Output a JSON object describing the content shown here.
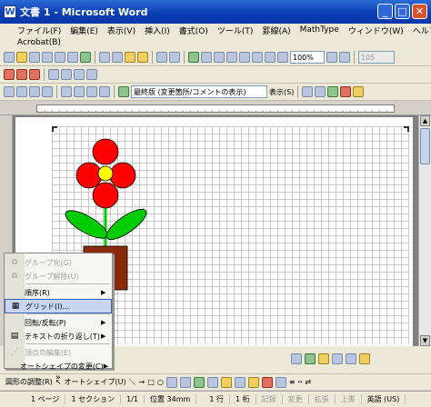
{
  "window": {
    "title": "文書 1 - Microsoft Word",
    "app_icon": "W"
  },
  "menu": [
    "ファイル(F)",
    "編集(E)",
    "表示(V)",
    "挿入(I)",
    "書式(O)",
    "ツール(T)",
    "罫線(A)",
    "MathType",
    "ウィンドウ(W)",
    "ヘルプ(H)"
  ],
  "menu_row2": "Acrobat(B)",
  "toolbar": {
    "zoom": "100%",
    "font_size": "105",
    "review_display": "最終版 (変更箇所/コメントの表示)",
    "show_button": "表示(S)"
  },
  "context_menu": {
    "items": [
      {
        "label": "グループ化(G)",
        "disabled": true,
        "submenu": false,
        "icon": "group-icon"
      },
      {
        "label": "グループ解除(U)",
        "disabled": true,
        "submenu": false,
        "icon": "ungroup-icon"
      },
      {
        "label": "順序(R)",
        "disabled": false,
        "submenu": true,
        "icon": ""
      },
      {
        "label": "グリッド(I)...",
        "disabled": false,
        "submenu": false,
        "icon": "grid-icon",
        "highlighted": true
      },
      {
        "label": "回転/反転(P)",
        "disabled": false,
        "submenu": true,
        "icon": ""
      },
      {
        "label": "テキストの折り返し(T)",
        "disabled": false,
        "submenu": true,
        "icon": "wrap-icon"
      },
      {
        "label": "頂点の編集(E)",
        "disabled": true,
        "submenu": false,
        "icon": "edit-points-icon"
      },
      {
        "label": "オートシェイプの変更(C)",
        "disabled": false,
        "submenu": true,
        "icon": ""
      }
    ],
    "more_chevron": "»"
  },
  "drawing_toolbar": {
    "draw_menu": "図形の調整(R)",
    "autoshape_menu": "オートシェイプ(U)"
  },
  "status": {
    "page": "1 ページ",
    "section": "1 セクション",
    "pages": "1/1",
    "position": "位置 34mm",
    "line": "1 行",
    "column": "1 桁",
    "rec": "記録",
    "trk": "変更",
    "ext": "拡張",
    "ovr": "上書",
    "language": "英語 (US)"
  },
  "colors": {
    "petal": "#ff0000",
    "center": "#ffff00",
    "leaf": "#00cc00",
    "pot": "#8b2a0a"
  }
}
